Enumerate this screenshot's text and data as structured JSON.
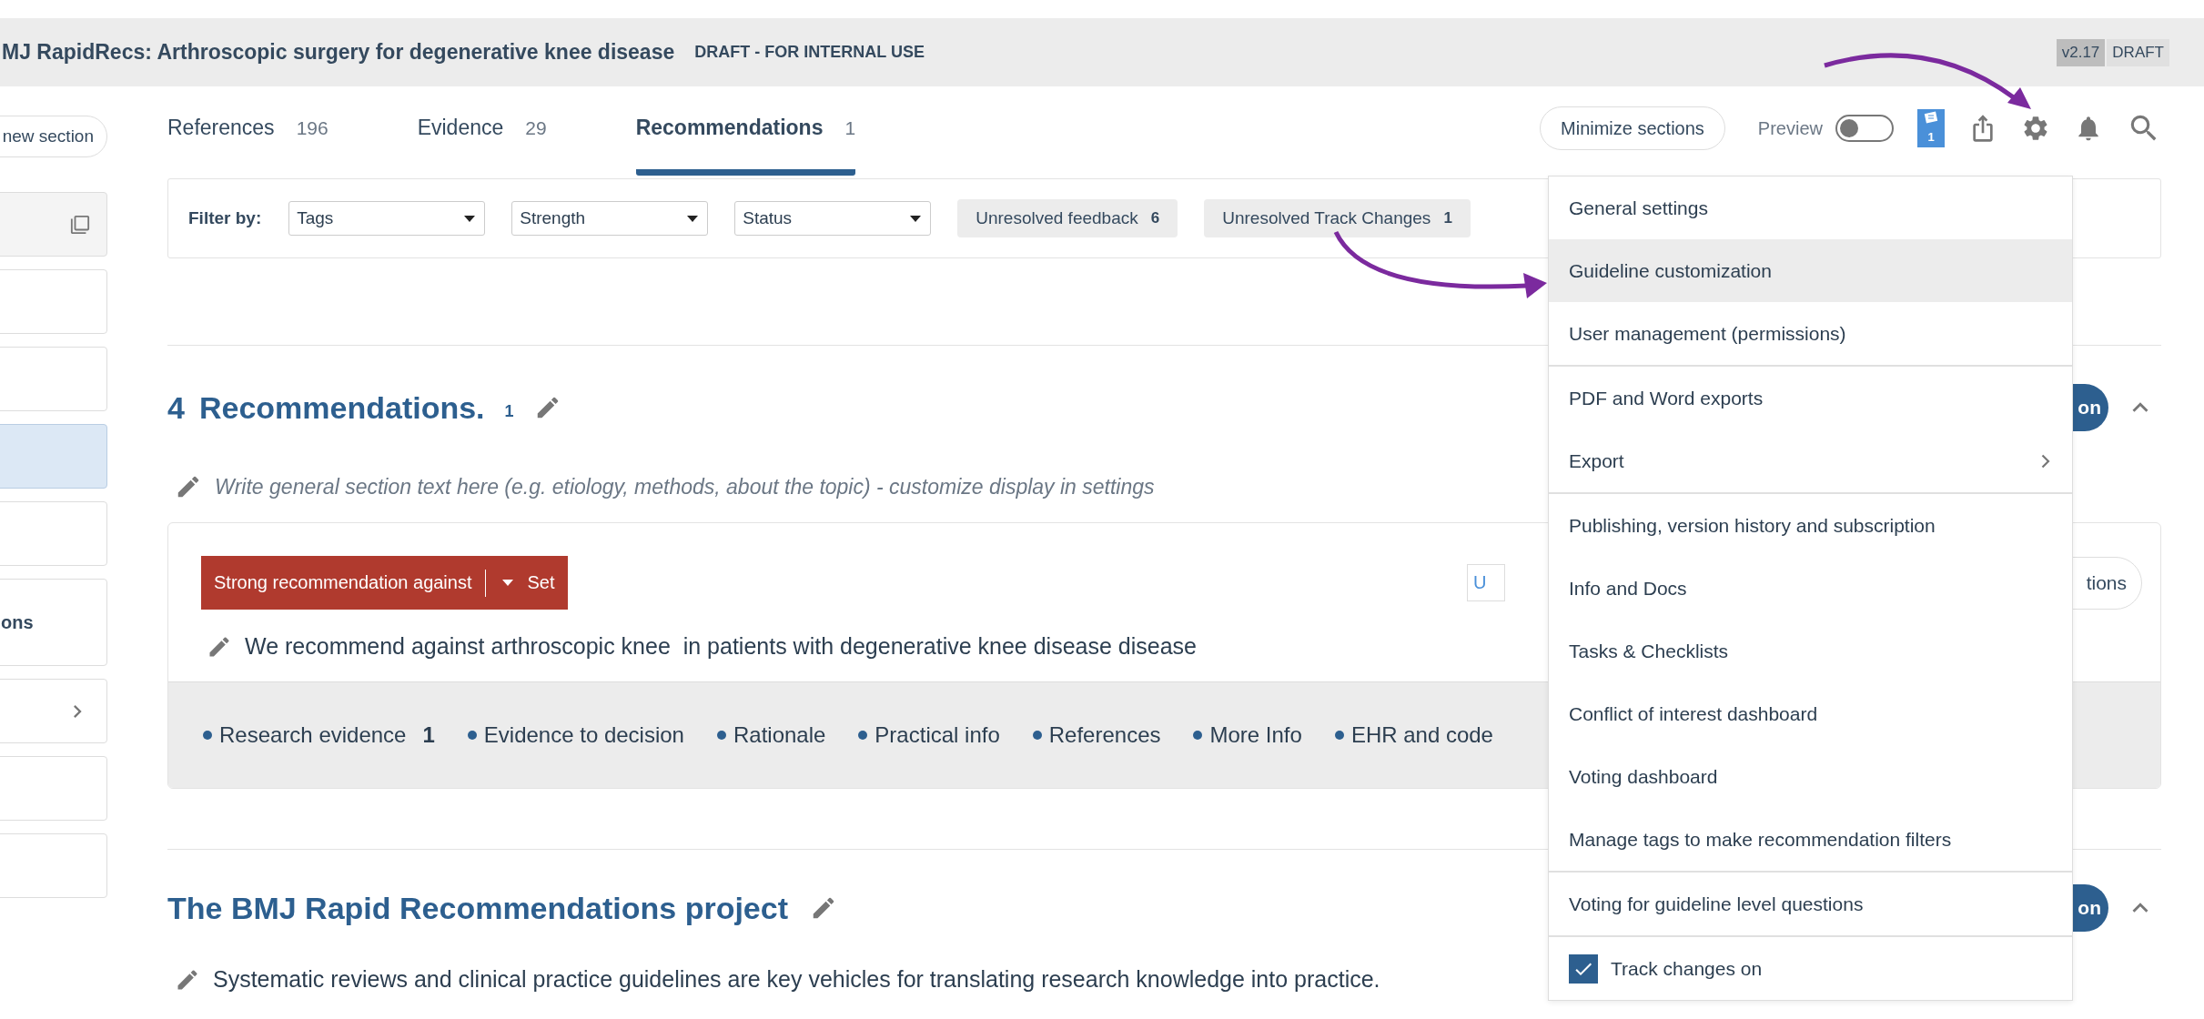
{
  "header": {
    "title": "MJ RapidRecs: Arthroscopic surgery for degenerative knee disease",
    "status": "DRAFT - FOR INTERNAL USE",
    "version": "v2.17",
    "version_status": "DRAFT"
  },
  "sidebar": {
    "new_section_button": "new section",
    "items": [
      {
        "kind": "copy",
        "selected": false
      },
      {
        "kind": "blank",
        "selected": false
      },
      {
        "kind": "blank",
        "selected": false
      },
      {
        "kind": "blank",
        "selected": true
      },
      {
        "kind": "blank",
        "selected": false
      },
      {
        "kind": "label",
        "label": "ons",
        "selected": false
      },
      {
        "kind": "chevron",
        "selected": false
      },
      {
        "kind": "blank",
        "selected": false
      },
      {
        "kind": "blank",
        "selected": false
      }
    ]
  },
  "tabs": [
    {
      "label": "References",
      "count": "196",
      "selected": false
    },
    {
      "label": "Evidence",
      "count": "29",
      "selected": false
    },
    {
      "label": "Recommendations",
      "count": "1",
      "selected": true
    }
  ],
  "toolbar": {
    "minimize_button": "Minimize sections",
    "preview": {
      "label": "Preview",
      "on": false
    },
    "checklist_badge": "1"
  },
  "filter": {
    "label": "Filter by:",
    "selects": [
      "Tags",
      "Strength",
      "Status"
    ],
    "chips": [
      {
        "label": "Unresolved feedback",
        "count": "6"
      },
      {
        "label": "Unresolved Track Changes",
        "count": "1"
      }
    ]
  },
  "sections": [
    {
      "number": "4",
      "title": "Recommendations.",
      "count": "1",
      "placeholder": "Write general section text here (e.g. etiology, methods, about the topic) - customize display in settings",
      "side_button": "on",
      "expanded": true,
      "recommendation": {
        "strength": "Strong recommendation against",
        "set_label": "Set",
        "text": "We recommend against arthroscopic knee  in patients with degenerative knee disease disease",
        "tag": "U",
        "options_button": "tions",
        "tabs": [
          {
            "label": "Research evidence",
            "count": "1"
          },
          {
            "label": "Evidence to decision"
          },
          {
            "label": "Rationale"
          },
          {
            "label": "Practical info"
          },
          {
            "label": "References"
          },
          {
            "label": "More Info"
          },
          {
            "label": "EHR and code"
          }
        ]
      }
    },
    {
      "title": "The BMJ Rapid Recommendations project",
      "text": "Systematic reviews and clinical practice guidelines are key vehicles for translating research knowledge into practice.",
      "side_button": "on",
      "expanded": true
    }
  ],
  "menu": {
    "groups": [
      [
        {
          "kind": "link",
          "label": "General settings",
          "selected": false
        },
        {
          "kind": "link",
          "label": "Guideline customization",
          "selected": true
        },
        {
          "kind": "link",
          "label": "User management (permissions)",
          "selected": false
        }
      ],
      [
        {
          "kind": "link",
          "label": "PDF and Word exports",
          "selected": false
        },
        {
          "kind": "submenu",
          "label": "Export",
          "selected": false
        }
      ],
      [
        {
          "kind": "link",
          "label": "Publishing, version history and subscription",
          "selected": false
        },
        {
          "kind": "link",
          "label": "Info and Docs",
          "selected": false
        },
        {
          "kind": "link",
          "label": "Tasks & Checklists",
          "selected": false
        },
        {
          "kind": "link",
          "label": "Conflict of interest dashboard",
          "selected": false
        },
        {
          "kind": "link",
          "label": "Voting dashboard",
          "selected": false
        },
        {
          "kind": "link",
          "label": "Manage tags to make recommendation filters",
          "selected": false
        }
      ],
      [
        {
          "kind": "link",
          "label": "Voting for guideline level questions",
          "selected": false
        }
      ],
      [
        {
          "kind": "checkbox",
          "label": "Track changes on",
          "checked": true,
          "selected": false
        }
      ]
    ]
  }
}
